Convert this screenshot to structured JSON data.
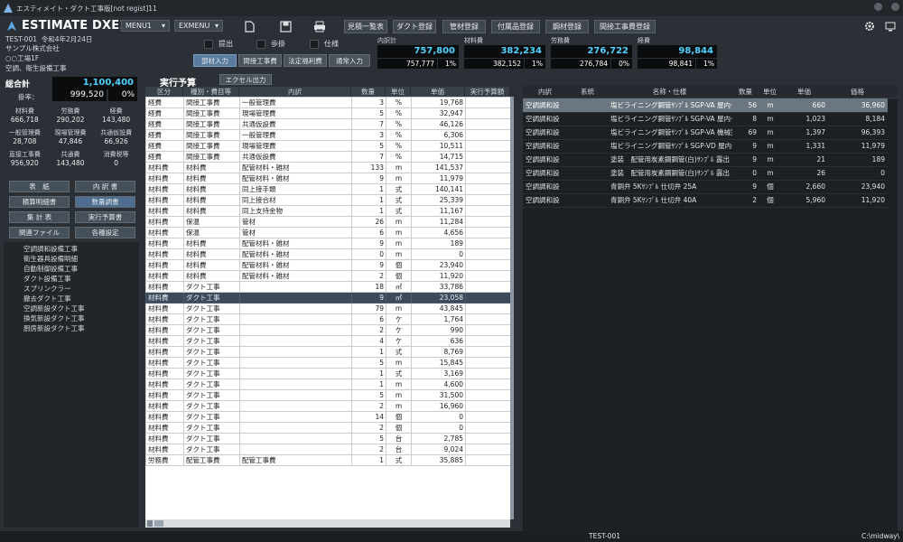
{
  "window": {
    "title": "エスティメイト・ダクト工事版[not regist]11"
  },
  "app": {
    "name": "ESTIMATE DXE11",
    "menu1": "MENU1",
    "exmenu": "EXMENU"
  },
  "toolbar_buttons": [
    "見積一覧表",
    "ダクト登録",
    "管材登録",
    "付属品登録",
    "鋼材登録",
    "間接工事費登録"
  ],
  "project": {
    "code": "TEST-001",
    "date": "令和4年2月24日",
    "company": "サンプル株式会社",
    "site": "○○工場1F",
    "work": "空調、衛生設備工事"
  },
  "checks": {
    "submit": "提出",
    "rate": "歩掛",
    "spec": "仕様"
  },
  "modes": {
    "items": [
      "部材入力",
      "間接工事費",
      "法定福利費",
      "通常入力"
    ],
    "active": 0
  },
  "summary": {
    "subtotal": {
      "label": "内訳計",
      "value": "757,800",
      "sub": "757,777",
      "pct": "1%"
    },
    "material": {
      "label": "材料費",
      "value": "382,234",
      "sub": "382,152",
      "pct": "1%"
    },
    "labor": {
      "label": "労務費",
      "value": "276,722",
      "sub": "276,784",
      "pct": "0%"
    },
    "expense": {
      "label": "経費",
      "value": "98,844",
      "sub": "98,841",
      "pct": "1%"
    }
  },
  "total": {
    "label": "総合計",
    "value": "1,100,400",
    "rate_label": "掛率：",
    "rate_value": "999,520",
    "rate_pct": "0%"
  },
  "cost_grid": [
    {
      "label": "材料費",
      "value": "666,718"
    },
    {
      "label": "労務費",
      "value": "290,202"
    },
    {
      "label": "経費",
      "value": "143,480"
    },
    {
      "label": "一般管理費",
      "value": "28,708"
    },
    {
      "label": "現場管理費",
      "value": "47,846"
    },
    {
      "label": "共通仮設費",
      "value": "66,926"
    },
    {
      "label": "直接工事費",
      "value": "956,920"
    },
    {
      "label": "共通費",
      "value": "143,480"
    },
    {
      "label": "消費税等",
      "value": "0"
    }
  ],
  "nav_buttons": [
    "表　紙",
    "内 訳 書",
    "積算明細書",
    "数量調書",
    "集 計 表",
    "実行予算書",
    "関連ファイル",
    "各種設定"
  ],
  "nav_active": [
    3
  ],
  "tree": [
    "空調調和設備工事",
    "衛生器具設備明細",
    "自動制御設備工事",
    "ダクト設備工事",
    "スプリンクラー",
    "撤去ダクト工事",
    "空調新設ダクト工事",
    "換気新設ダクト工事",
    "厨房新設ダクト工事"
  ],
  "center": {
    "title": "実行予算",
    "excel_button": "エクセル出力",
    "headers": [
      "区分",
      "種別・費目等",
      "内訳",
      "数量",
      "単位",
      "単価",
      "実行予算額"
    ],
    "selected_row": 18,
    "rows": [
      [
        "経費",
        "間接工事費",
        "一般管理費",
        "3",
        "%",
        "19,768",
        ""
      ],
      [
        "経費",
        "間接工事費",
        "現場管理費",
        "5",
        "%",
        "32,947",
        ""
      ],
      [
        "経費",
        "間接工事費",
        "共通仮設費",
        "7",
        "%",
        "46,126",
        ""
      ],
      [
        "経費",
        "間接工事費",
        "一般管理費",
        "3",
        "%",
        "6,306",
        ""
      ],
      [
        "経費",
        "間接工事費",
        "現場管理費",
        "5",
        "%",
        "10,511",
        ""
      ],
      [
        "経費",
        "間接工事費",
        "共通仮設費",
        "7",
        "%",
        "14,715",
        ""
      ],
      [
        "材料費",
        "材料費",
        "配管材料・雑材",
        "133",
        "m",
        "141,537",
        ""
      ],
      [
        "材料費",
        "材料費",
        "配管材料・雑材",
        "9",
        "m",
        "11,979",
        ""
      ],
      [
        "材料費",
        "材料費",
        "同上接手類",
        "1",
        "式",
        "140,141",
        ""
      ],
      [
        "材料費",
        "材料費",
        "同上接合材",
        "1",
        "式",
        "25,339",
        ""
      ],
      [
        "材料費",
        "材料費",
        "同上支持金物",
        "1",
        "式",
        "11,167",
        ""
      ],
      [
        "材料費",
        "保温",
        "管材",
        "26",
        "m",
        "11,284",
        ""
      ],
      [
        "材料費",
        "保温",
        "管材",
        "6",
        "m",
        "4,656",
        ""
      ],
      [
        "材料費",
        "材料費",
        "配管材料・雑材",
        "9",
        "m",
        "189",
        ""
      ],
      [
        "材料費",
        "材料費",
        "配管材料・雑材",
        "0",
        "m",
        "0",
        ""
      ],
      [
        "材料費",
        "材料費",
        "配管材料・雑材",
        "9",
        "個",
        "23,940",
        ""
      ],
      [
        "材料費",
        "材料費",
        "配管材料・雑材",
        "2",
        "個",
        "11,920",
        ""
      ],
      [
        "材料費",
        "ダクト工事",
        "",
        "18",
        "㎡",
        "33,786",
        ""
      ],
      [
        "材料費",
        "ダクト工事",
        "",
        "9",
        "㎡",
        "23,058",
        ""
      ],
      [
        "材料費",
        "ダクト工事",
        "",
        "79",
        "m",
        "43,845",
        ""
      ],
      [
        "材料費",
        "ダクト工事",
        "",
        "6",
        "ケ",
        "1,764",
        ""
      ],
      [
        "材料費",
        "ダクト工事",
        "",
        "2",
        "ケ",
        "990",
        ""
      ],
      [
        "材料費",
        "ダクト工事",
        "",
        "4",
        "ケ",
        "636",
        ""
      ],
      [
        "材料費",
        "ダクト工事",
        "",
        "1",
        "式",
        "8,769",
        ""
      ],
      [
        "材料費",
        "ダクト工事",
        "",
        "5",
        "m",
        "15,845",
        ""
      ],
      [
        "材料費",
        "ダクト工事",
        "",
        "1",
        "式",
        "3,169",
        ""
      ],
      [
        "材料費",
        "ダクト工事",
        "",
        "1",
        "m",
        "4,600",
        ""
      ],
      [
        "材料費",
        "ダクト工事",
        "",
        "5",
        "m",
        "31,500",
        ""
      ],
      [
        "材料費",
        "ダクト工事",
        "",
        "2",
        "m",
        "16,960",
        ""
      ],
      [
        "材料費",
        "ダクト工事",
        "",
        "14",
        "個",
        "0",
        ""
      ],
      [
        "材料費",
        "ダクト工事",
        "",
        "2",
        "個",
        "0",
        ""
      ],
      [
        "材料費",
        "ダクト工事",
        "",
        "5",
        "台",
        "2,785",
        ""
      ],
      [
        "材料費",
        "ダクト工事",
        "",
        "2",
        "台",
        "9,024",
        ""
      ],
      [
        "労務費",
        "配管工事費",
        "配管工事費",
        "1",
        "式",
        "35,885",
        ""
      ]
    ]
  },
  "right": {
    "headers": [
      "内訳",
      "系統",
      "名称・仕様",
      "数量",
      "単位",
      "単価",
      "価格"
    ],
    "selected_row": 0,
    "rows": [
      [
        "空調調和設",
        "",
        "塩ビライニング鋼管ｻﾝﾌﾟﾙ SGP-VA 屋内一",
        "56",
        "m",
        "660",
        "36,960"
      ],
      [
        "空調調和設",
        "",
        "塩ビライニング鋼管ｻﾝﾌﾟﾙ SGP-VA 屋内一",
        "8",
        "m",
        "1,023",
        "8,184"
      ],
      [
        "空調調和設",
        "",
        "塩ビライニング鋼管ｻﾝﾌﾟﾙ SGP-VA 機械室",
        "69",
        "m",
        "1,397",
        "96,393"
      ],
      [
        "空調調和設",
        "",
        "塩ビライニング鋼管ｻﾝﾌﾟﾙ SGP-VD 屋内一",
        "9",
        "m",
        "1,331",
        "11,979"
      ],
      [
        "空調調和設",
        "",
        "塗装　配管用炭素鋼鋼管(白)ｻﾝﾌﾟﾙ 露出 s",
        "9",
        "m",
        "21",
        "189"
      ],
      [
        "空調調和設",
        "",
        "塗装　配管用炭素鋼鋼管(白)ｻﾝﾌﾟﾙ 露出 s",
        "0",
        "m",
        "26",
        "0"
      ],
      [
        "空調調和設",
        "",
        "青銅弁 5Kｻﾝﾌﾟﾙ 仕切弁 25A",
        "9",
        "個",
        "2,660",
        "23,940"
      ],
      [
        "空調調和設",
        "",
        "青銅弁 5Kｻﾝﾌﾟﾙ 仕切弁 40A",
        "2",
        "個",
        "5,960",
        "11,920"
      ]
    ]
  },
  "status": {
    "center": "TEST-001",
    "right": "C:\\midway\\"
  }
}
